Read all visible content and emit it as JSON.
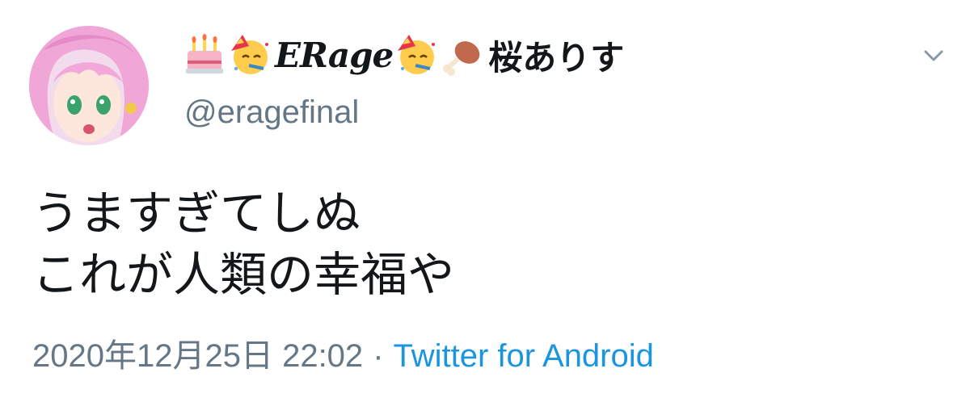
{
  "author": {
    "avatar": "avatar-anime-girl-pink-hair",
    "name_parts": [
      {
        "type": "emoji",
        "icon": "birthday-cake-icon"
      },
      {
        "type": "emoji",
        "icon": "partying-face-icon"
      },
      {
        "type": "text",
        "text": "ERage"
      },
      {
        "type": "emoji",
        "icon": "partying-face-icon"
      },
      {
        "type": "emoji",
        "icon": "poultry-leg-icon"
      },
      {
        "type": "text",
        "text": "桜ありす"
      }
    ],
    "name_latin": "ERage",
    "name_jp": "桜ありす",
    "handle": "@eragefinal"
  },
  "menu": {
    "icon": "chevron-down-icon"
  },
  "tweet": {
    "lines": [
      "うますぎてしぬ",
      "これが人類の幸福や"
    ],
    "timestamp": "2020年12月25日 22:02",
    "separator": "·",
    "source": "Twitter for Android"
  },
  "colors": {
    "text": "#14171a",
    "secondary": "#657786",
    "link": "#1b95e0",
    "background": "#ffffff"
  }
}
